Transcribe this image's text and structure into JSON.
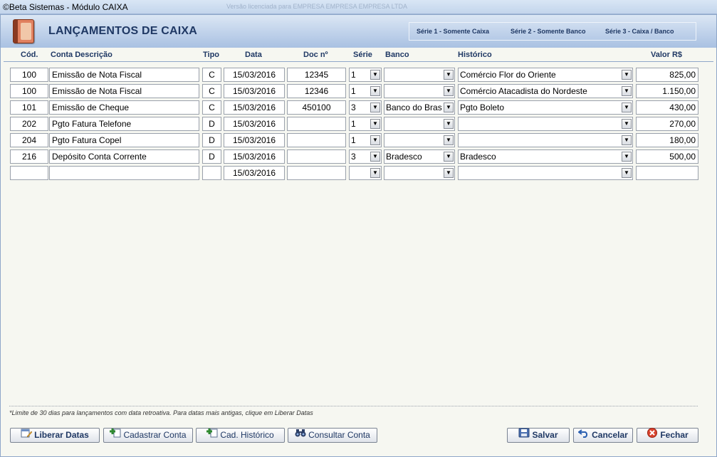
{
  "window": {
    "title": "©Beta Sistemas - Módulo CAIXA",
    "center_caption": "Versão licenciada para EMPRESA EMPRESA EMPRESA LTDA"
  },
  "header": {
    "title": "LANÇAMENTOS DE CAIXA",
    "series": [
      "Série 1 - Somente Caixa",
      "Série 2 - Somente Banco",
      "Série 3 - Caixa / Banco"
    ]
  },
  "columns": {
    "cod": "Cód.",
    "conta": "Conta Descrição",
    "tipo": "Tipo",
    "data": "Data",
    "doc": "Doc nº",
    "serie": "Série",
    "banco": "Banco",
    "historico": "Histórico",
    "valor": "Valor R$"
  },
  "rows": [
    {
      "cod": "100",
      "conta": "Emissão de Nota Fiscal",
      "tipo": "C",
      "data": "15/03/2016",
      "doc": "12345",
      "serie": "1",
      "banco": "",
      "historico": "Comércio Flor do Oriente",
      "valor": "825,00"
    },
    {
      "cod": "100",
      "conta": "Emissão de Nota Fiscal",
      "tipo": "C",
      "data": "15/03/2016",
      "doc": "12346",
      "serie": "1",
      "banco": "",
      "historico": "Comércio Atacadista do Nordeste",
      "valor": "1.150,00"
    },
    {
      "cod": "101",
      "conta": "Emissão de Cheque",
      "tipo": "C",
      "data": "15/03/2016",
      "doc": "450100",
      "serie": "3",
      "banco": "Banco do Bras",
      "historico": "Pgto Boleto",
      "valor": "430,00"
    },
    {
      "cod": "202",
      "conta": "Pgto Fatura Telefone",
      "tipo": "D",
      "data": "15/03/2016",
      "doc": "",
      "serie": "1",
      "banco": "",
      "historico": "",
      "valor": "270,00"
    },
    {
      "cod": "204",
      "conta": "Pgto Fatura Copel",
      "tipo": "D",
      "data": "15/03/2016",
      "doc": "",
      "serie": "1",
      "banco": "",
      "historico": "",
      "valor": "180,00"
    },
    {
      "cod": "216",
      "conta": "Depósito Conta Corrente",
      "tipo": "D",
      "data": "15/03/2016",
      "doc": "",
      "serie": "3",
      "banco": "Bradesco",
      "historico": "Bradesco",
      "valor": "500,00"
    },
    {
      "cod": "",
      "conta": "",
      "tipo": "",
      "data": "15/03/2016",
      "doc": "",
      "serie": "",
      "banco": "",
      "historico": "",
      "valor": ""
    }
  ],
  "footer": {
    "note": "*Limite de 30 dias para lançamentos com data retroativa. Para datas mais antigas, clique em Liberar Datas",
    "buttons": {
      "liberar": "Liberar Datas",
      "cadastrar": "Cadastrar Conta",
      "historico": "Cad. Histórico",
      "consultar": "Consultar Conta",
      "salvar": "Salvar",
      "cancelar": "Cancelar",
      "fechar": "Fechar"
    }
  },
  "icons": {
    "app": "ledger-book-icon",
    "liberar": "calendar-edit-icon",
    "cadastrar": "add-icon",
    "historico": "add-icon",
    "consultar": "binoculars-icon",
    "salvar": "save-icon",
    "cancelar": "undo-icon",
    "fechar": "close-icon",
    "combo": "chevron-down-icon"
  },
  "colors": {
    "accent": "#1f3864",
    "header_top": "#dbe6f4",
    "header_bottom": "#a9c1e2",
    "close_red": "#d9432f"
  }
}
